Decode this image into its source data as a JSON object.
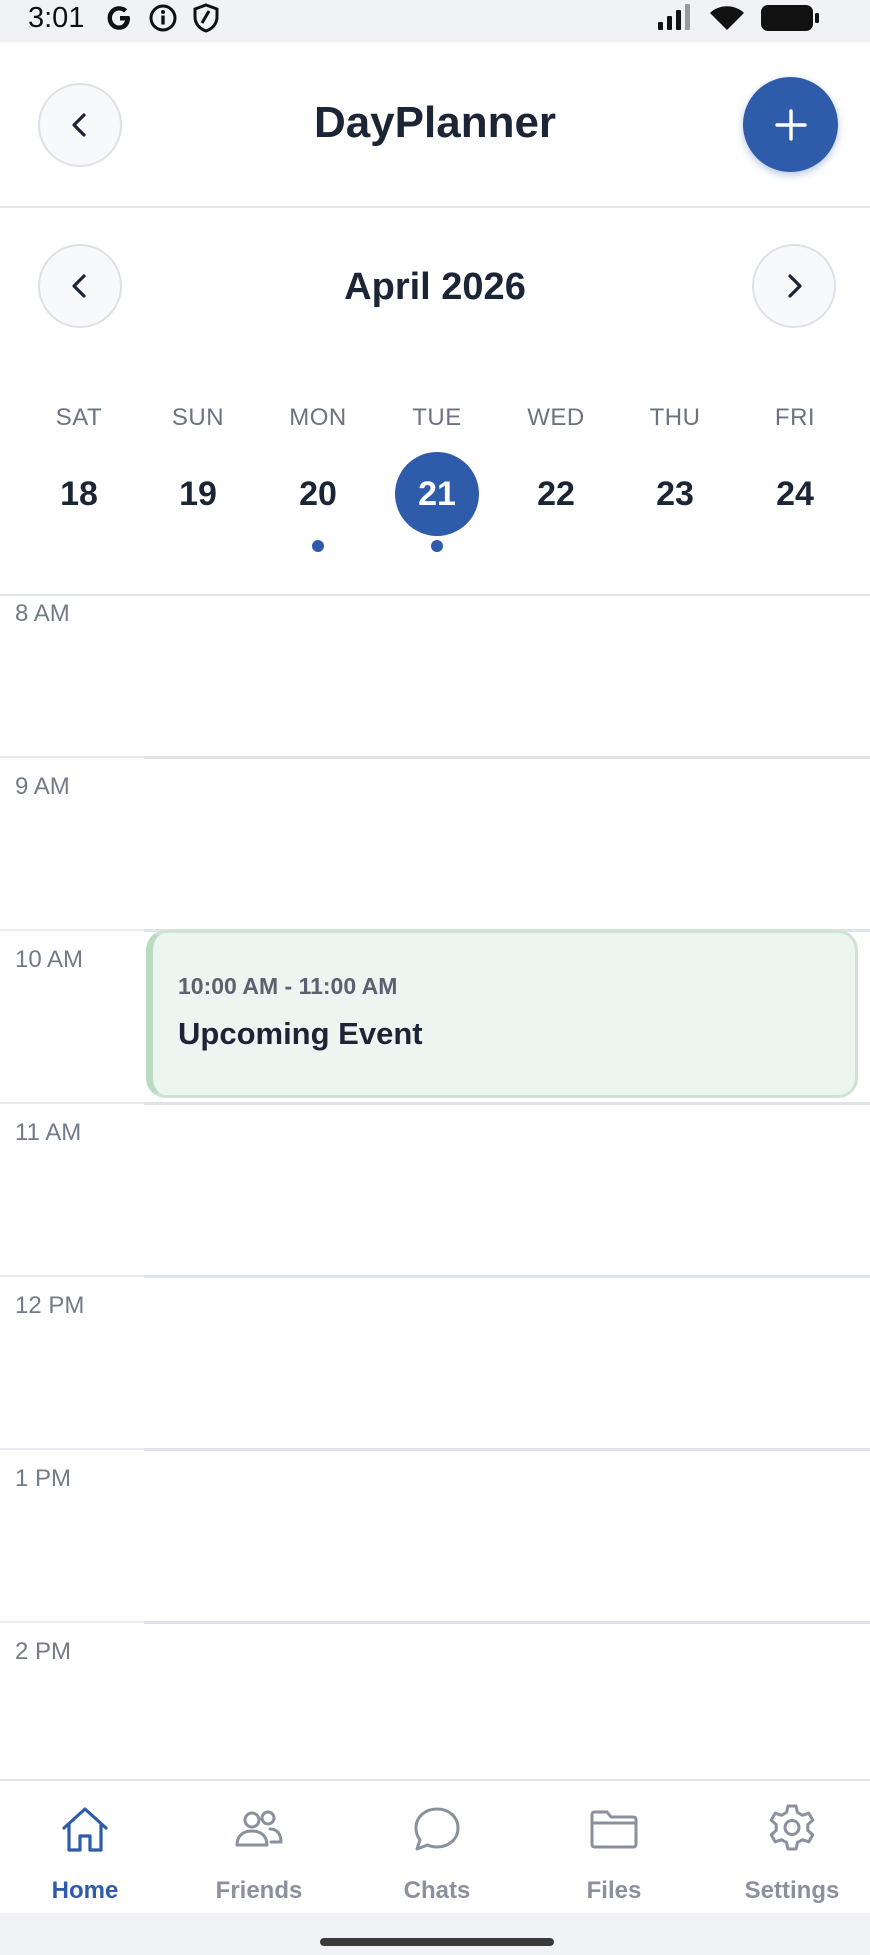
{
  "status_bar": {
    "time": "3:01",
    "left_icons": [
      "google-icon",
      "info-icon",
      "shield-icon"
    ],
    "right_icons": [
      "signal-icon",
      "wifi-icon",
      "battery-icon"
    ]
  },
  "header": {
    "title": "DayPlanner",
    "back_icon": "chevron-left-icon",
    "add_icon": "plus-icon"
  },
  "calendar": {
    "month_label": "April 2026",
    "prev_icon": "chevron-left-icon",
    "next_icon": "chevron-right-icon",
    "days": [
      {
        "dow": "SAT",
        "num": "18",
        "selected": false,
        "has_event": false
      },
      {
        "dow": "SUN",
        "num": "19",
        "selected": false,
        "has_event": false
      },
      {
        "dow": "MON",
        "num": "20",
        "selected": false,
        "has_event": true
      },
      {
        "dow": "TUE",
        "num": "21",
        "selected": true,
        "has_event": true
      },
      {
        "dow": "WED",
        "num": "22",
        "selected": false,
        "has_event": false
      },
      {
        "dow": "THU",
        "num": "23",
        "selected": false,
        "has_event": false
      },
      {
        "dow": "FRI",
        "num": "24",
        "selected": false,
        "has_event": false
      }
    ]
  },
  "timeline": {
    "hours": [
      "8 AM",
      "9 AM",
      "10 AM",
      "11 AM",
      "12 PM",
      "1 PM",
      "2 PM"
    ],
    "event": {
      "time": "10:00 AM - 11:00 AM",
      "title": "Upcoming Event"
    }
  },
  "bottom_nav": [
    {
      "label": "Home",
      "icon": "home-icon",
      "active": true
    },
    {
      "label": "Friends",
      "icon": "friends-icon",
      "active": false
    },
    {
      "label": "Chats",
      "icon": "chat-icon",
      "active": false
    },
    {
      "label": "Files",
      "icon": "folder-icon",
      "active": false
    },
    {
      "label": "Settings",
      "icon": "gear-icon",
      "active": false
    }
  ],
  "colors": {
    "accent": "#2f5bab",
    "event_bg": "#ecf5ef",
    "event_border": "#b8dbc1"
  }
}
